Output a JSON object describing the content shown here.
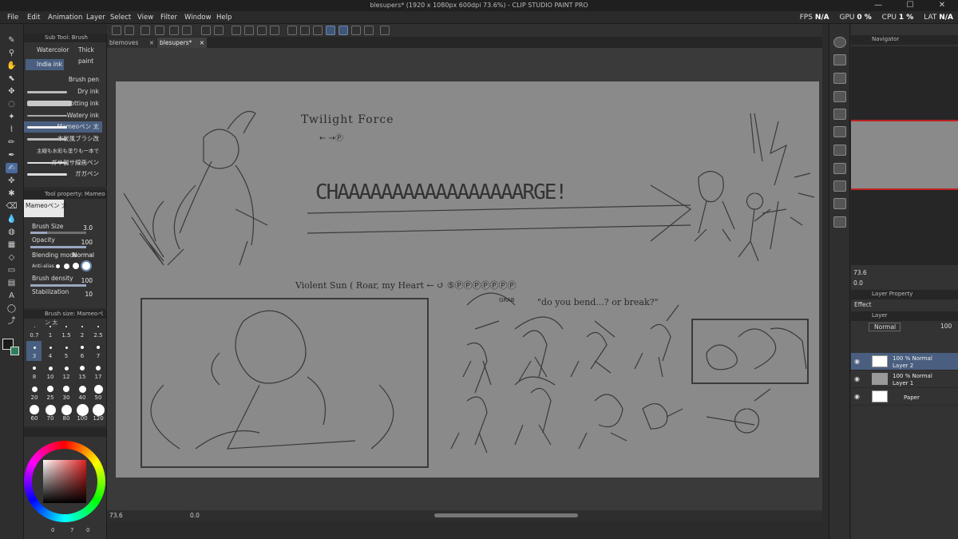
{
  "window": {
    "title": "blesupers* (1920 x 1080px 600dpi 73.6%) - CLIP STUDIO PAINT PRO",
    "minimize": "—",
    "maximize": "☐",
    "close": "✕"
  },
  "menu": [
    "File",
    "Edit",
    "Animation",
    "Layer",
    "Select",
    "View",
    "Filter",
    "Window",
    "Help"
  ],
  "stats": {
    "fps_label": "FPS",
    "fps_value": "N/A",
    "gpu_label": "GPU",
    "gpu_value": "0 %",
    "cpu_label": "CPU",
    "cpu_value": "1 %",
    "lat_label": "LAT",
    "lat_value": "N/A"
  },
  "tabs": [
    {
      "label": "blemoves",
      "close": "×"
    },
    {
      "label": "blesupers*",
      "close": "×"
    }
  ],
  "subtool": {
    "header": "Sub Tool: Brush",
    "groups": [
      "Watercolor",
      "Thick paint",
      "India ink"
    ],
    "brushes": [
      "Brush pen",
      "Dry ink",
      "Wet blotting ink",
      "Watery ink",
      "Mameoペン 太",
      "木炭風ブラシ改",
      "主線も水彩も塗りも一本で",
      "ガサ伽サ線画ペン",
      "ガガペン"
    ]
  },
  "toolprop": {
    "header": "Tool property: Mameoペン 太",
    "preset_name": "Mameoペン 太",
    "brush_size_label": "Brush Size",
    "brush_size_value": "3.0",
    "opacity_label": "Opacity",
    "opacity_value": "100",
    "blending_label": "Blending mode",
    "blending_value": "Normal",
    "antialias_label": "Anti-alias",
    "density_label": "Brush density",
    "density_value": "100",
    "stabilization_label": "Stabilization",
    "stabilization_value": "10"
  },
  "brushsize": {
    "header": "Brush size: Mameoペン 太",
    "sizes": [
      "0.7",
      "1",
      "1.5",
      "2",
      "2.5",
      "3",
      "4",
      "5",
      "6",
      "7",
      "8",
      "10",
      "12",
      "15",
      "17",
      "20",
      "25",
      "30",
      "40",
      "50",
      "60",
      "70",
      "80",
      "100",
      "120"
    ],
    "selected": "3"
  },
  "colors": {
    "main": "#1a1a1a",
    "sub": "#2e7d5b"
  },
  "color_wheel_footer": [
    "0",
    "7",
    "0"
  ],
  "canvas": {
    "label_twilight": "Twilight Force",
    "label_arrow_note": "← →Ⓟ",
    "scream": "CHAAAAAAAAAAAAAAAAARGE!",
    "label_violent": "Violent Sun ( Roar, my Heart ← ↺ ⑤ⓅⓅⓅⓅⓅⓅⓅ",
    "label_grab": "GRAB",
    "label_quote": "\"do you bend...? or break?\""
  },
  "bottom": {
    "zoom": "73.6",
    "angle": "0.0"
  },
  "navigator": {
    "header": "Navigator",
    "zoom": "73.6",
    "angle": "0.0"
  },
  "layer_property": {
    "header": "Layer Property",
    "effect_label": "Effect"
  },
  "layers_panel": {
    "header": "Layer",
    "blend": "Normal",
    "opacity": "100",
    "layers": [
      {
        "mode": "100 % Normal",
        "name": "Layer 2"
      },
      {
        "mode": "100 % Normal",
        "name": "Layer 1"
      },
      {
        "mode": "",
        "name": "Paper"
      }
    ]
  }
}
